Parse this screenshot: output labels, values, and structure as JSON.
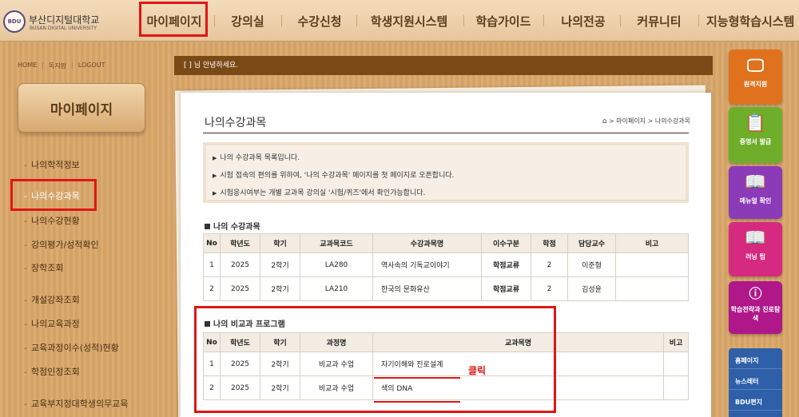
{
  "header": {
    "logo_ko": "부산디지털대학교",
    "logo_en": "BUSAN DIGITAL UNIVERSITY",
    "logo_seal": "BDU",
    "nav": [
      "마이페이지",
      "강의실",
      "수강신청",
      "학생지원시스템",
      "학습가이드",
      "나의전공",
      "커뮤니티",
      "지능형학습시스템"
    ]
  },
  "sidebar": {
    "util": [
      "HOME",
      "독지팜",
      "LOGOUT"
    ],
    "title": "마이페이지",
    "items": [
      "나의학적정보",
      "나의수강과목",
      "나의수강현황",
      "강의평가/성적확인",
      "장학조회",
      "개설강좌조회",
      "나의교육과정",
      "교육과정이수(성적)현황",
      "학점인정조회",
      "교육부지정대학생의무교육"
    ],
    "active_index": 1
  },
  "greeting": "[          ] 님 안녕하세요.",
  "page": {
    "title": "나의수강과목",
    "breadcrumb": "> 마이페이지 > 나의수강과목",
    "notices": [
      "나의 수강과목 목록입니다.",
      "시험 접속의 편의를 위하여, '나의 수강과목' 페이지를 첫 페이지로 오픈합니다.",
      "시험응시여부는 개별 교과목 강의실 '시험/퀴즈'에서 확인가능합니다."
    ]
  },
  "courses": {
    "title": "나의 수강과목",
    "headers": [
      "No",
      "학년도",
      "학기",
      "교과목코드",
      "수강과목명",
      "이수구분",
      "학점",
      "담당교수",
      "비고"
    ],
    "rows": [
      [
        "1",
        "2025",
        "2학기",
        "LA280",
        "역사속의 기독교이야기",
        "학점교류",
        "2",
        "이준형",
        ""
      ],
      [
        "2",
        "2025",
        "2학기",
        "LA210",
        "한국의 문화유산",
        "학점교류",
        "2",
        "김성윤",
        ""
      ]
    ]
  },
  "programs": {
    "title": "나의 비교과 프로그램",
    "headers": [
      "No",
      "학년도",
      "학기",
      "과정명",
      "교과목명",
      "비고"
    ],
    "rows": [
      [
        "1",
        "2025",
        "2학기",
        "비교과 수업",
        "자기이해와 진로설계",
        ""
      ],
      [
        "2",
        "2025",
        "2학기",
        "비교과 수업",
        "색의 DNA",
        ""
      ]
    ]
  },
  "annotation": {
    "click": "클릭"
  },
  "quickbar": {
    "items": [
      {
        "label": "원격지원",
        "icon": "monitor-icon",
        "color": "#e0711d"
      },
      {
        "label": "증명서 발급",
        "icon": "certificate-icon",
        "color": "#6fae2a"
      },
      {
        "label": "메뉴얼 확인",
        "icon": "book-icon",
        "color": "#8b3ab8"
      },
      {
        "label": "러닝 팁",
        "icon": "open-book-icon",
        "color": "#d62a80"
      },
      {
        "label": "학습전략과 진로탐색",
        "icon": "info-icon",
        "color": "#b0188a"
      }
    ],
    "links": [
      "홈페이지",
      "뉴스레터",
      "BDU편지"
    ]
  },
  "colors": {
    "highlight": "#e01616",
    "greeting_bar": "#7a4a16",
    "quick_links": "#2e5fa8"
  }
}
